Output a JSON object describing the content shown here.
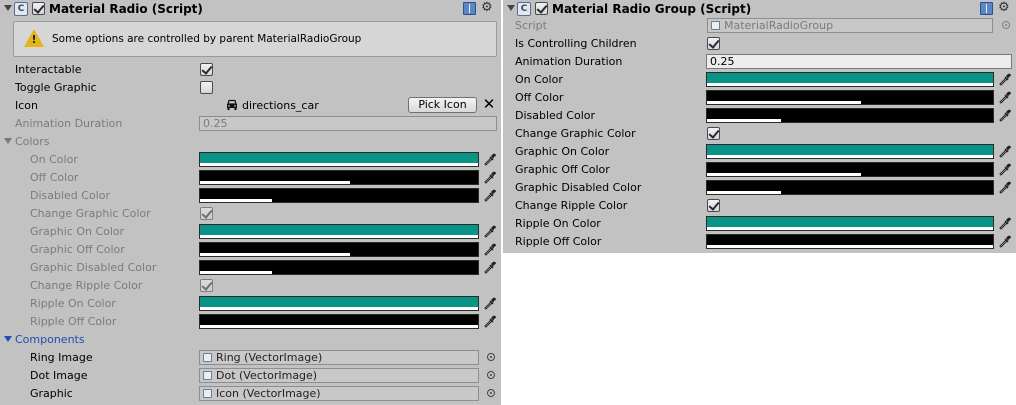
{
  "colors": {
    "teal": "#0a9488",
    "black": "#000000",
    "white": "#ffffff",
    "panel": "#c2c2c2"
  },
  "left": {
    "header": {
      "title": "Material Radio (Script)",
      "icons": [
        "script-icon",
        "enabled-checkbox",
        "help-book-icon",
        "gear-icon"
      ]
    },
    "warning": {
      "text": "Some options are controlled by parent MaterialRadioGroup",
      "icon": "warning-icon"
    },
    "interactable": {
      "label": "Interactable",
      "checked": true
    },
    "toggle_graphic": {
      "label": "Toggle Graphic",
      "checked": false
    },
    "icon": {
      "label": "Icon",
      "value": "directions_car",
      "pick_label": "Pick Icon",
      "clear_glyph": "✕"
    },
    "animation_duration": {
      "label": "Animation Duration",
      "value": "0.25"
    },
    "colors_section": {
      "label": "Colors"
    },
    "on_color": {
      "label": "On Color",
      "color": "#0a9488",
      "alpha": 1.0
    },
    "off_color": {
      "label": "Off Color",
      "color": "#000000",
      "alpha": 0.54
    },
    "disabled_color": {
      "label": "Disabled Color",
      "color": "#000000",
      "alpha": 0.26
    },
    "change_graphic_color": {
      "label": "Change Graphic Color",
      "checked": true
    },
    "graphic_on_color": {
      "label": "Graphic On Color",
      "color": "#0a9488",
      "alpha": 1.0
    },
    "graphic_off_color": {
      "label": "Graphic Off Color",
      "color": "#000000",
      "alpha": 0.54
    },
    "graphic_disabled_color": {
      "label": "Graphic Disabled Color",
      "color": "#000000",
      "alpha": 0.26
    },
    "change_ripple_color": {
      "label": "Change Ripple Color",
      "checked": true
    },
    "ripple_on_color": {
      "label": "Ripple On Color",
      "color": "#0a9488",
      "alpha": 1.0
    },
    "ripple_off_color": {
      "label": "Ripple Off Color",
      "color": "#000000",
      "alpha": 1.0
    },
    "components_section": {
      "label": "Components"
    },
    "ring_image": {
      "label": "Ring Image",
      "value": "Ring (VectorImage)"
    },
    "dot_image": {
      "label": "Dot Image",
      "value": "Dot (VectorImage)"
    },
    "graphic": {
      "label": "Graphic",
      "value": "Icon (VectorImage)"
    }
  },
  "right": {
    "header": {
      "title": "Material Radio Group (Script)"
    },
    "script": {
      "label": "Script",
      "value": "MaterialRadioGroup"
    },
    "is_controlling_children": {
      "label": "Is Controlling Children",
      "checked": true
    },
    "animation_duration": {
      "label": "Animation Duration",
      "value": "0.25"
    },
    "on_color": {
      "label": "On Color",
      "color": "#0a9488",
      "alpha": 1.0
    },
    "off_color": {
      "label": "Off Color",
      "color": "#000000",
      "alpha": 0.54
    },
    "disabled_color": {
      "label": "Disabled Color",
      "color": "#000000",
      "alpha": 0.26
    },
    "change_graphic_color": {
      "label": "Change Graphic Color",
      "checked": true
    },
    "graphic_on_color": {
      "label": "Graphic On Color",
      "color": "#0a9488",
      "alpha": 1.0
    },
    "graphic_off_color": {
      "label": "Graphic Off Color",
      "color": "#000000",
      "alpha": 0.54
    },
    "graphic_disabled_color": {
      "label": "Graphic Disabled Color",
      "color": "#000000",
      "alpha": 0.26
    },
    "change_ripple_color": {
      "label": "Change Ripple Color",
      "checked": true
    },
    "ripple_on_color": {
      "label": "Ripple On Color",
      "color": "#0a9488",
      "alpha": 1.0
    },
    "ripple_off_color": {
      "label": "Ripple Off Color",
      "color": "#000000",
      "alpha": 1.0
    }
  }
}
